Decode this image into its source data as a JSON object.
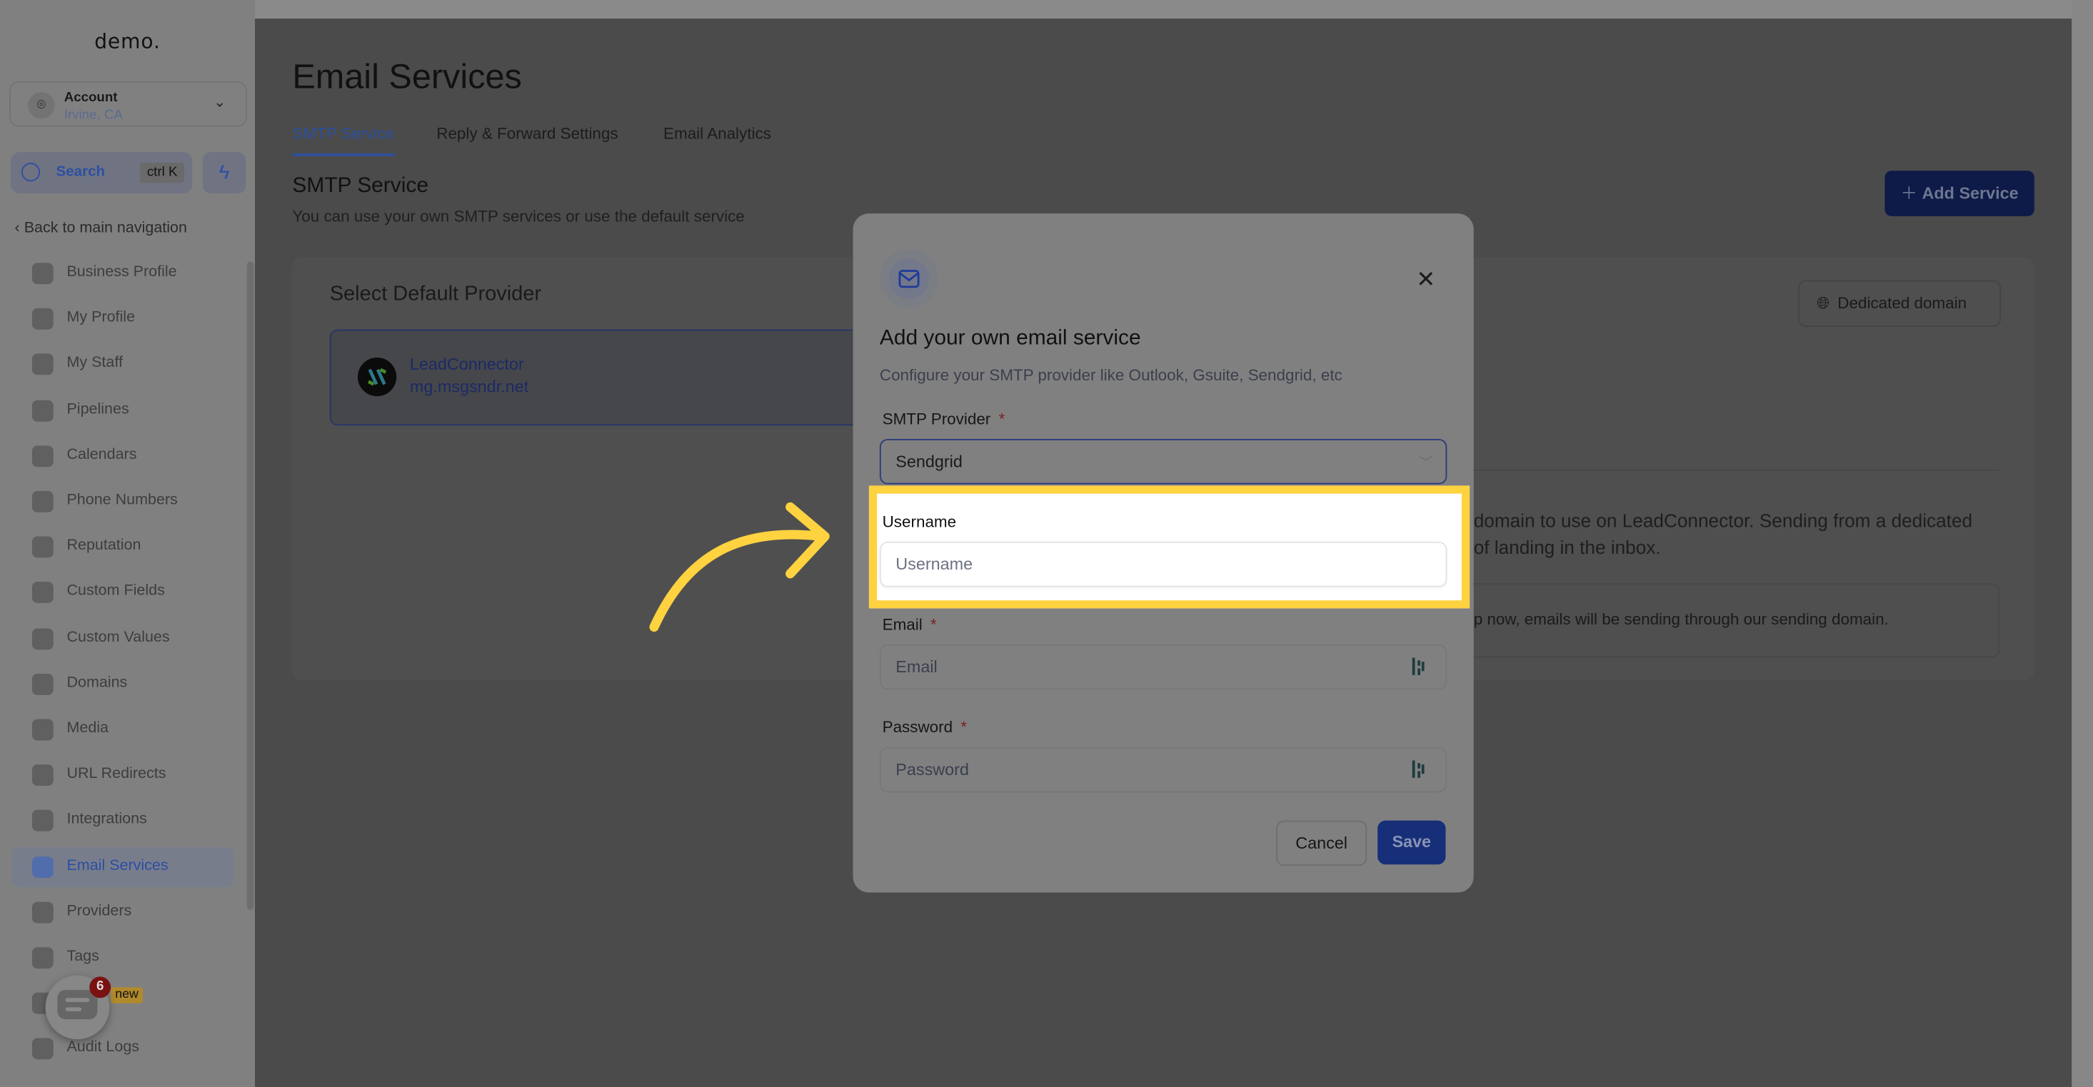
{
  "sidebar": {
    "logo": "demo.",
    "account": {
      "name": "Account",
      "location": "Irvine, CA"
    },
    "search": {
      "label": "Search",
      "shortcut": "ctrl K"
    },
    "back_label": "Back to main navigation",
    "items": [
      {
        "label": "Business Profile",
        "icon": "briefcase-icon"
      },
      {
        "label": "My Profile",
        "icon": "user-circle-icon"
      },
      {
        "label": "My Staff",
        "icon": "user-icon"
      },
      {
        "label": "Pipelines",
        "icon": "filter-icon"
      },
      {
        "label": "Calendars",
        "icon": "calendar-icon"
      },
      {
        "label": "Phone Numbers",
        "icon": "phone-icon"
      },
      {
        "label": "Reputation",
        "icon": "star-icon"
      },
      {
        "label": "Custom Fields",
        "icon": "fields-icon"
      },
      {
        "label": "Custom Values",
        "icon": "tag-values-icon"
      },
      {
        "label": "Domains",
        "icon": "globe-icon"
      },
      {
        "label": "Media",
        "icon": "media-icon"
      },
      {
        "label": "URL Redirects",
        "icon": "redirect-icon"
      },
      {
        "label": "Integrations",
        "icon": "integrations-icon"
      },
      {
        "label": "Email Services",
        "icon": "email-icon",
        "active": true
      },
      {
        "label": "Providers",
        "icon": "providers-icon"
      },
      {
        "label": "Tags",
        "icon": "tag-icon"
      },
      {
        "label": "",
        "icon": "flask-icon"
      },
      {
        "label": "Audit Logs",
        "icon": "bar-chart-icon"
      }
    ],
    "chat": {
      "badge_count": "6",
      "new_badge": "new"
    }
  },
  "main": {
    "title": "Email Services",
    "tabs": [
      {
        "label": "SMTP Service",
        "active": true
      },
      {
        "label": "Reply & Forward Settings"
      },
      {
        "label": "Email Analytics"
      }
    ],
    "section_title": "SMTP Service",
    "section_subtitle": "You can use your own SMTP services or use the default service",
    "add_service_label": "Add Service",
    "card": {
      "title": "Select Default Provider",
      "provider": {
        "name": "LeadConnector",
        "domain": "mg.msgsndr.net"
      },
      "dedicated_domain_label": "Dedicated domain",
      "desc_line1": "domain to use on LeadConnector. Sending from a dedicated",
      "desc_line2": "of landing in the inbox.",
      "info_text": "p now, emails will be sending through our sending domain."
    }
  },
  "modal": {
    "title": "Add your own email service",
    "subtitle": "Configure your SMTP provider like Outlook, Gsuite, Sendgrid, etc",
    "smtp_provider": {
      "label": "SMTP Provider",
      "required": "*",
      "value": "Sendgrid"
    },
    "username": {
      "label": "Username",
      "placeholder": "Username"
    },
    "email": {
      "label": "Email",
      "required": "*",
      "placeholder": "Email"
    },
    "password": {
      "label": "Password",
      "required": "*",
      "placeholder": "Password"
    },
    "cancel_label": "Cancel",
    "save_label": "Save"
  },
  "colors": {
    "accent": "#2d4f9e",
    "highlight": "#ffd240",
    "primary_button": "#172f78"
  }
}
